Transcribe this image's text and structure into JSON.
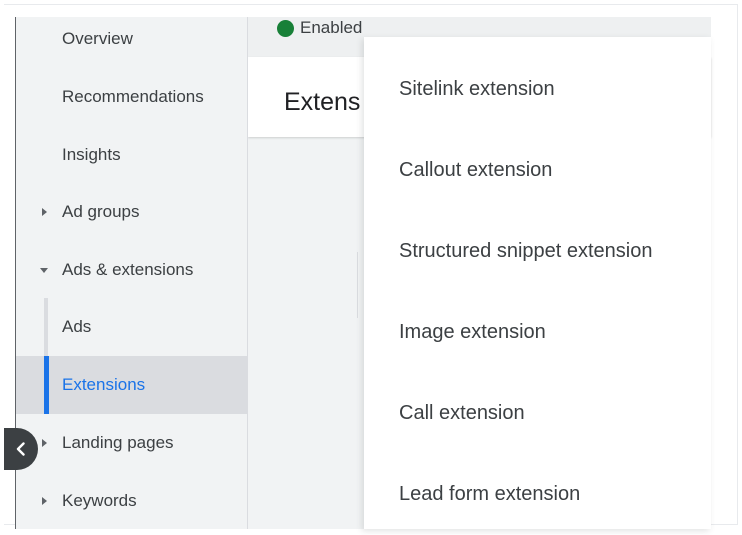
{
  "sidebar": {
    "items": [
      {
        "label": "Overview"
      },
      {
        "label": "Recommendations"
      },
      {
        "label": "Insights"
      },
      {
        "label": "Ad groups"
      },
      {
        "label": "Ads & extensions"
      },
      {
        "label": "Ads"
      },
      {
        "label": "Extensions"
      },
      {
        "label": "Landing pages"
      },
      {
        "label": "Keywords"
      }
    ],
    "active_item": "Extensions"
  },
  "main": {
    "status_text": "Enabled",
    "title": "Extens"
  },
  "menu": {
    "items": [
      {
        "label": "Sitelink extension"
      },
      {
        "label": "Callout extension"
      },
      {
        "label": "Structured snippet extension"
      },
      {
        "label": "Image extension"
      },
      {
        "label": "Call extension"
      },
      {
        "label": "Lead form extension"
      }
    ]
  },
  "colors": {
    "accent": "#1a73e8",
    "status_enabled": "#188038",
    "sidebar_bg": "#f1f3f4",
    "active_bg": "#dadce0"
  },
  "icons": {
    "collapse": "chevron-left-icon",
    "expand": "caret-right-icon",
    "expanded": "caret-down-icon",
    "status": "status-dot-icon"
  }
}
